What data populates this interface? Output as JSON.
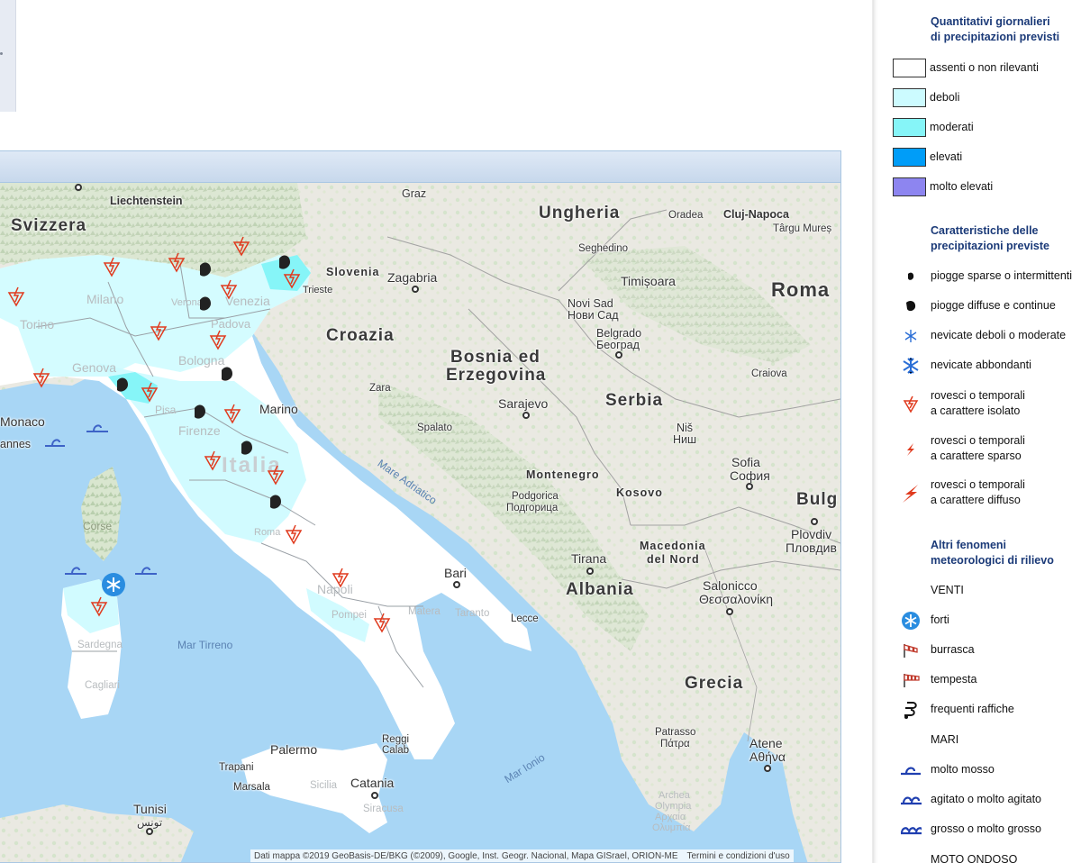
{
  "legend": {
    "title_quantity": [
      "Quantitativi giornalieri",
      "di precipitazioni previsti"
    ],
    "quantity_items": [
      {
        "label": "assenti o non rilevanti",
        "color": "#ffffff"
      },
      {
        "label": "deboli",
        "color": "#ccfbff"
      },
      {
        "label": "moderati",
        "color": "#86f5f8"
      },
      {
        "label": "elevati",
        "color": "#009df8"
      },
      {
        "label": "molto elevati",
        "color": "#8d85f0"
      }
    ],
    "title_characteristics": [
      "Caratteristiche delle",
      "precipitazioni previste"
    ],
    "characteristic_items": [
      {
        "icon": "drop-small-icon",
        "lines": [
          "piogge sparse o intermittenti"
        ]
      },
      {
        "icon": "drop-large-icon",
        "lines": [
          "piogge diffuse e continue"
        ]
      },
      {
        "icon": "snowflake-small-icon",
        "lines": [
          "nevicate deboli o moderate"
        ]
      },
      {
        "icon": "snowflake-large-icon",
        "lines": [
          "nevicate abbondanti"
        ]
      },
      {
        "icon": "storm-isolated-icon",
        "lines": [
          "rovesci o temporali",
          "a carattere isolato"
        ]
      },
      {
        "icon": "storm-scattered-icon",
        "lines": [
          "rovesci o temporali",
          "a carattere sparso"
        ]
      },
      {
        "icon": "storm-widespread-icon",
        "lines": [
          "rovesci o temporali",
          "a carattere diffuso"
        ]
      }
    ],
    "title_other": [
      "Altri fenomeni",
      "meteorologici di rilievo"
    ],
    "winds_heading": "VENTI",
    "wind_items": [
      {
        "icon": "wind-strong-icon",
        "label": "forti"
      },
      {
        "icon": "windsock-gale-icon",
        "label": "burrasca"
      },
      {
        "icon": "windsock-storm-icon",
        "label": "tempesta"
      },
      {
        "icon": "gust-icon",
        "label": "frequenti raffiche"
      }
    ],
    "seas_heading": "MARI",
    "sea_items": [
      {
        "icon": "wave-one-icon",
        "label": "molto mosso"
      },
      {
        "icon": "wave-two-icon",
        "label": "agitato o molto agitato"
      },
      {
        "icon": "wave-three-icon",
        "label": "grosso o molto grosso"
      }
    ],
    "next_heading": "MOTO ONDOSO"
  },
  "map": {
    "countries": {
      "svizzera": "Svizzera",
      "ungheria": "Ungheria",
      "romania": "Roma",
      "croazia": "Croazia",
      "bosnia": [
        "Bosnia ed",
        "Erzegovina"
      ],
      "serbia": "Serbia",
      "albania": "Albania",
      "bulgaria": "Bulg",
      "grecia": "Grecia",
      "kosovo": "Kosovo",
      "montenegro": "Montenegro",
      "slovenia": "Slovenia",
      "macedonia": [
        "Macedonia",
        "del Nord"
      ],
      "italia": "Italia"
    },
    "cities": {
      "liechtenstein": "Liechtenstein",
      "graz": "Graz",
      "cluj": "Cluj-Napoca",
      "targu": "Târgu Mureș",
      "oradea": "Oradea",
      "seghedino": "Seghedino",
      "timisoara": "Timișoara",
      "zagabria": "Zagabria",
      "trieste": "Trieste",
      "venezia": "Venezia",
      "padova": "Padova",
      "verona": "Verona",
      "milano": "Milano",
      "torino": "Torino",
      "genova": "Genova",
      "bologna": "Bologna",
      "monaco": "Monaco",
      "cannes": "annes",
      "pisa": "Pisa",
      "firenze": "Firenze",
      "marino": "Marino",
      "novisad": [
        "Novi Sad",
        "Нови Сад"
      ],
      "belgrado": [
        "Belgrado",
        "Београд"
      ],
      "craiova": "Craiova",
      "nis": [
        "Niš",
        "Ниш"
      ],
      "sofia": [
        "Sofia",
        "София"
      ],
      "plovdiv": [
        "Plovdiv",
        "Пловдив"
      ],
      "sarajevo": "Sarajevo",
      "zara": "Zara",
      "spalato": "Spalato",
      "podgorica": [
        "Podgorica",
        "Подгорица"
      ],
      "tirana": "Tirana",
      "salonicco": [
        "Salonicco",
        "Θεσσαλονίκη"
      ],
      "atene": [
        "Atene",
        "Αθήνα"
      ],
      "patrasso": [
        "Patrasso",
        "Πάτρα"
      ],
      "olimpia": [
        "Archea",
        "Olympia",
        "Αρχαία",
        "Ολυμπία"
      ],
      "bari": "Bari",
      "matera": "Matera",
      "taranto": "Taranto",
      "lecce": "Lecce",
      "napoli": "Napoli",
      "pompei": "Pompei",
      "corse": "Corse",
      "sardegna": "Sardegna",
      "cagliari": "Cagliari",
      "palermo": "Palermo",
      "trapani": "Trapani",
      "marsala": "Marsala",
      "sicilia": "Sicilia",
      "catania": "Catania",
      "siracusa": "Siracusa",
      "reggio": [
        "Reggi",
        "Calab"
      ],
      "tunisi": [
        "Tunisi",
        "تونس"
      ],
      "roma": "Roma"
    },
    "seas": {
      "adriatico": "Mare Adriatico",
      "tirreno": "Mar Tirreno",
      "ionio": "Mar Ionio"
    },
    "attribution": "Dati mappa ©2019 GeoBasis-DE/BKG (©2009), Google, Inst. Geogr. Nacional, Mapa GISrael, ORION-ME",
    "terms": "Termini e condizioni d'uso"
  }
}
